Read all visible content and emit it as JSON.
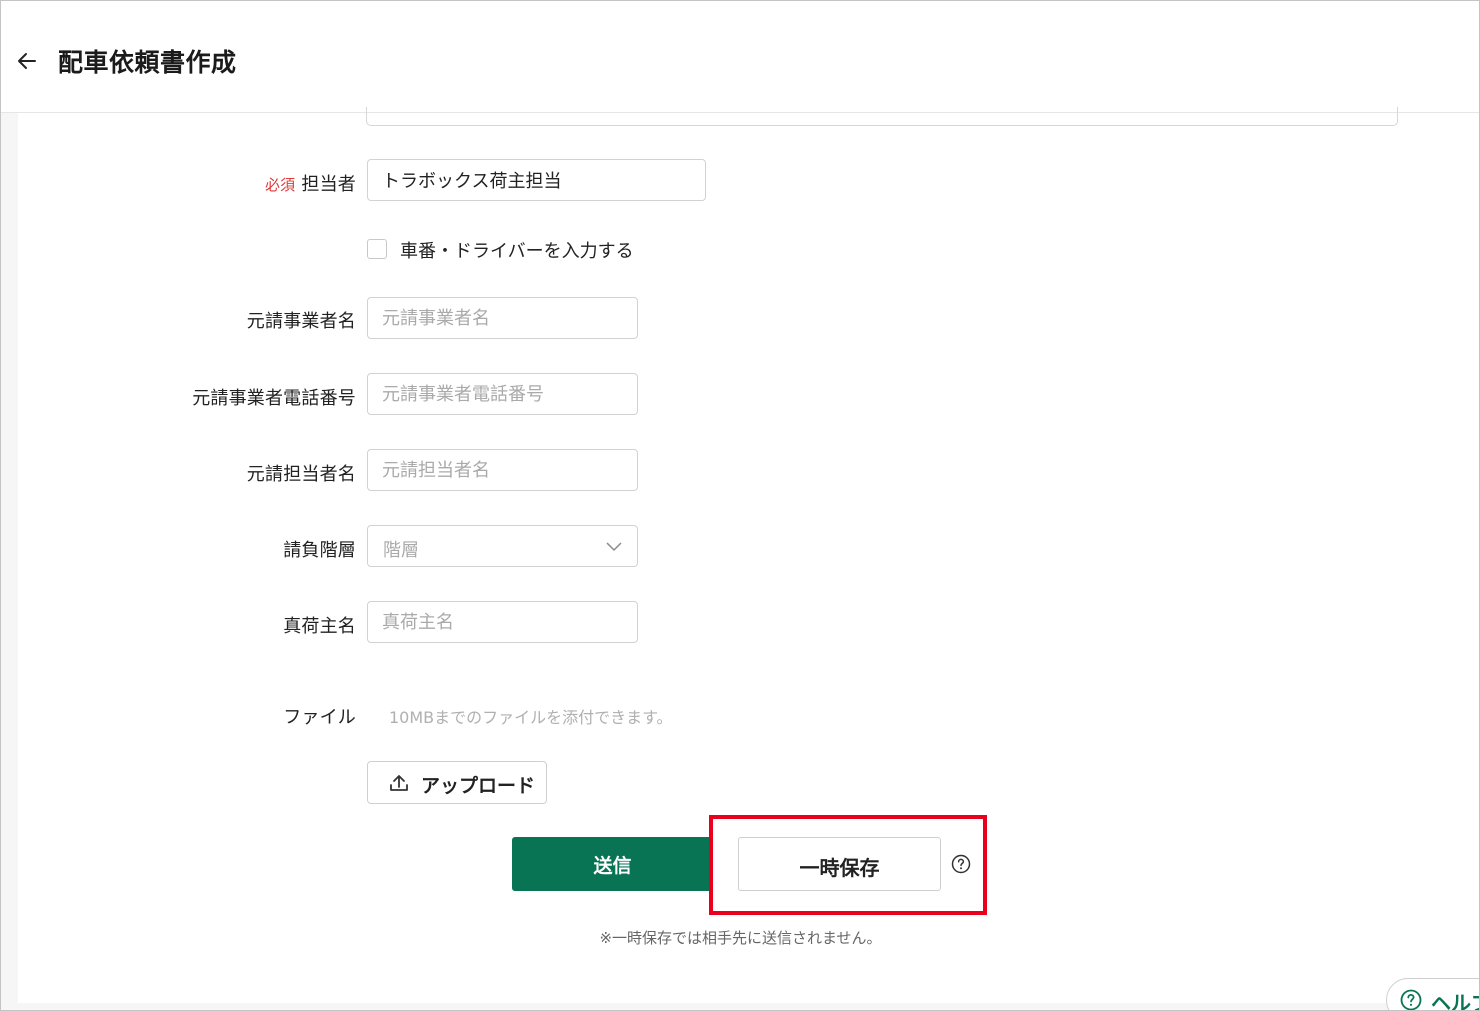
{
  "header": {
    "title": "配車依頼書作成"
  },
  "form": {
    "contact": {
      "required_badge": "必須",
      "label": "担当者",
      "value": "トラボックス荷主担当"
    },
    "vehicle_checkbox": {
      "label": "車番・ドライバーを入力する",
      "checked": false
    },
    "prime_contractor_name": {
      "label": "元請事業者名",
      "placeholder": "元請事業者名"
    },
    "prime_contractor_phone": {
      "label": "元請事業者電話番号",
      "placeholder": "元請事業者電話番号"
    },
    "prime_contact_name": {
      "label": "元請担当者名",
      "placeholder": "元請担当者名"
    },
    "subcontract_tier": {
      "label": "請負階層",
      "placeholder": "階層"
    },
    "true_shipper_name": {
      "label": "真荷主名",
      "placeholder": "真荷主名"
    },
    "file": {
      "label": "ファイル",
      "hint": "10MBまでのファイルを添付できます。",
      "upload_label": "アップロード"
    }
  },
  "actions": {
    "submit_label": "送信",
    "draft_label": "一時保存",
    "draft_note": "※一時保存では相手先に送信されません。"
  },
  "help_tab": {
    "label": "ヘルプ"
  },
  "colors": {
    "primary": "#087454",
    "required": "#e23a3a",
    "highlight": "#e8001c"
  }
}
